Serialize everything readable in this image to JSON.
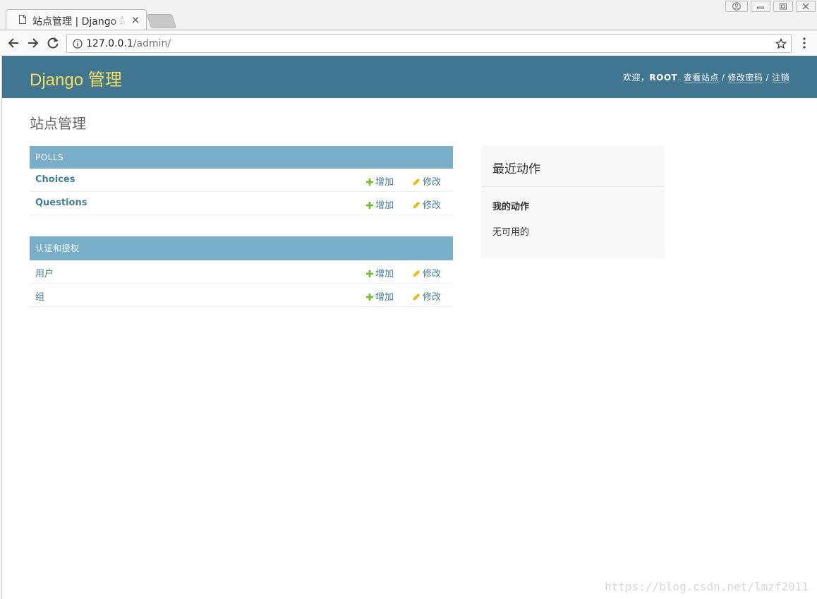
{
  "browser": {
    "tab_title": "站点管理 | Django 站点管理员",
    "tab_close": "×",
    "url_host": "127.0.0.1",
    "url_path": "/admin/"
  },
  "header": {
    "branding": "Django 管理",
    "welcome": "欢迎，",
    "username": "ROOT",
    "username_suffix": ".",
    "view_site": "查看站点",
    "change_password": "修改密码",
    "logout": "注销",
    "separator": "/"
  },
  "content": {
    "title": "站点管理"
  },
  "modules": [
    {
      "caption": "POLLS",
      "models": [
        {
          "name": "Choices",
          "add": "增加",
          "change": "修改"
        },
        {
          "name": "Questions",
          "add": "增加",
          "change": "修改"
        }
      ]
    },
    {
      "caption": "认证和授权",
      "models": [
        {
          "name": "用户",
          "add": "增加",
          "change": "修改"
        },
        {
          "name": "组",
          "add": "增加",
          "change": "修改"
        }
      ]
    }
  ],
  "recent_actions": {
    "title": "最近动作",
    "subtitle": "我的动作",
    "empty": "无可用的"
  },
  "watermark": "https://blog.csdn.net/lmzf2011",
  "colors": {
    "header_bg": "#417690",
    "branding": "#f5dd5d",
    "module_caption": "#79aec8",
    "link": "#447e9b",
    "add_icon": "#70bf2b",
    "change_icon": "#efb80b"
  }
}
